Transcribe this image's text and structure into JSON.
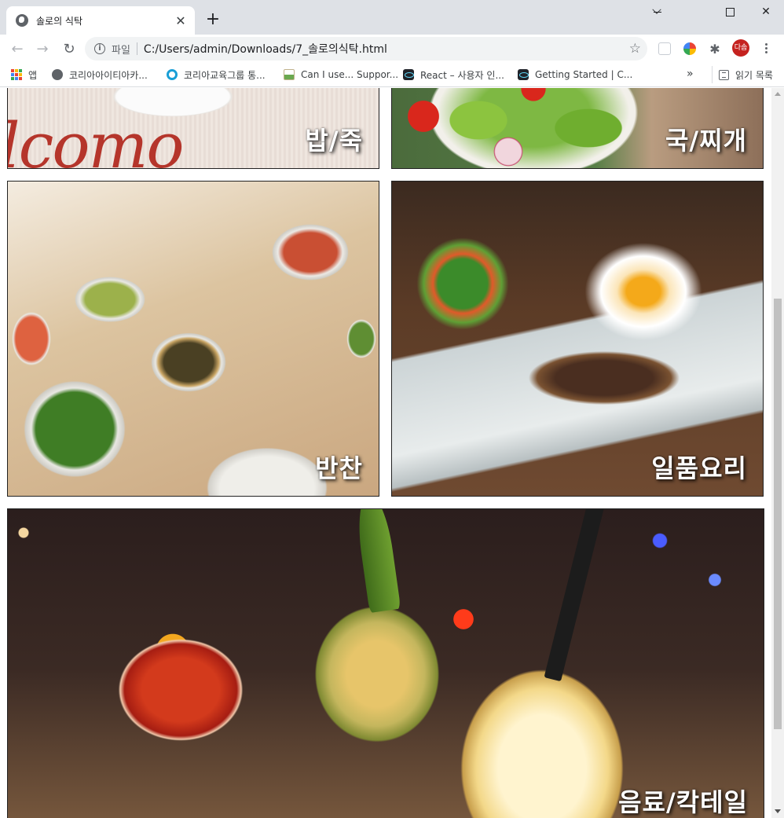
{
  "browser": {
    "tab": {
      "title": "솔로의 식탁",
      "close": "✕"
    },
    "new_tab": "+",
    "window_controls": {
      "minimize": "",
      "maximize": "",
      "close": "✕"
    },
    "nav": {
      "back": "←",
      "forward": "→",
      "reload": "↻"
    },
    "omnibox": {
      "scheme_label": "파일",
      "url": "C:/Users/admin/Downloads/7_솔로의식탁.html",
      "star": "☆"
    },
    "profile_initials": "다솜",
    "extensions_icon": "puzzle-icon",
    "bookmarks": [
      {
        "label": "앱",
        "icon": "apps-grid-icon"
      },
      {
        "label": "코리아아이티아카...",
        "icon": "globe-icon"
      },
      {
        "label": "코리아교육그룹 통...",
        "icon": "ring-icon"
      },
      {
        "label": "Can I use... Suppor...",
        "icon": "caniuse-icon"
      },
      {
        "label": "React – 사용자 인...",
        "icon": "react-icon"
      },
      {
        "label": "Getting Started | C...",
        "icon": "react-icon"
      }
    ],
    "bookmarks_more": "»",
    "reading_list": "읽기 목록"
  },
  "page": {
    "cards": {
      "rice": {
        "label": "밥/죽",
        "background_text": "lcomo"
      },
      "soup": {
        "label": "국/찌개"
      },
      "banchan": {
        "label": "반찬"
      },
      "dish": {
        "label": "일품요리"
      },
      "drink": {
        "label": "음료/칵테일"
      }
    }
  },
  "colors": {
    "chrome_tabstrip": "#dee1e6",
    "omnibox_bg": "#f1f3f4",
    "avatar_bg": "#c5221f",
    "card_border": "#222222",
    "label_text": "#ffffff"
  }
}
